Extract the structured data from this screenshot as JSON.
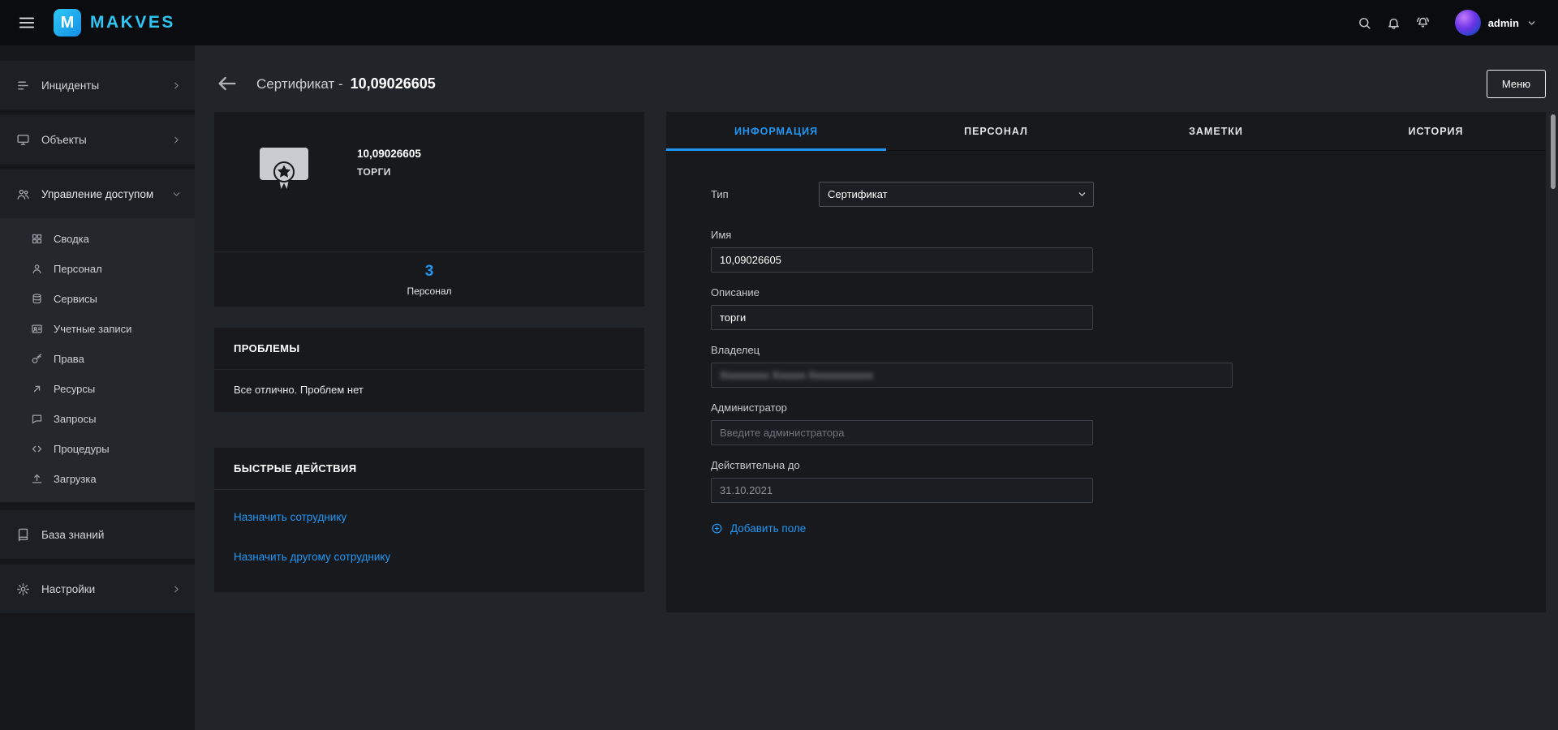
{
  "topbar": {
    "brand": "MAKVES",
    "user": "admin"
  },
  "sidebar": {
    "items": [
      {
        "id": "incidents",
        "label": "Инциденты",
        "icon": "incidents",
        "chevron": "right"
      },
      {
        "id": "objects",
        "label": "Объекты",
        "icon": "objects",
        "chevron": "right"
      },
      {
        "id": "access-management",
        "label": "Управление доступом",
        "icon": "access",
        "chevron": "down",
        "expanded": true
      },
      {
        "id": "knowledge-base",
        "label": "База знаний",
        "icon": "knowledge"
      },
      {
        "id": "settings",
        "label": "Настройки",
        "icon": "settings",
        "chevron": "right"
      }
    ],
    "submenu": [
      {
        "id": "summary",
        "label": "Сводка",
        "icon": "grid"
      },
      {
        "id": "personnel",
        "label": "Персонал",
        "icon": "person"
      },
      {
        "id": "services",
        "label": "Сервисы",
        "icon": "services"
      },
      {
        "id": "accounts",
        "label": "Учетные записи",
        "icon": "accounts"
      },
      {
        "id": "rights",
        "label": "Права",
        "icon": "rights"
      },
      {
        "id": "resources",
        "label": "Ресурсы",
        "icon": "resources"
      },
      {
        "id": "requests",
        "label": "Запросы",
        "icon": "requests"
      },
      {
        "id": "procedures",
        "label": "Процедуры",
        "icon": "procedures"
      },
      {
        "id": "upload",
        "label": "Загрузка",
        "icon": "upload"
      }
    ]
  },
  "header": {
    "title_prefix": "Сертификат -",
    "title_value": "10,09026605",
    "menu_button": "Меню"
  },
  "summary": {
    "name": "10,09026605",
    "subtitle": "ТОРГИ",
    "count": "3",
    "count_label": "Персонал"
  },
  "problems": {
    "title": "ПРОБЛЕМЫ",
    "message": "Все отлично. Проблем нет"
  },
  "quick_actions": {
    "title": "БЫСТРЫЕ ДЕЙСТВИЯ",
    "links": [
      "Назначить сотруднику",
      "Назначить другому сотруднику"
    ]
  },
  "tabs": [
    {
      "id": "information",
      "label": "ИНФОРМАЦИЯ",
      "active": true
    },
    {
      "id": "personnel",
      "label": "ПЕРСОНАЛ",
      "active": false
    },
    {
      "id": "notes",
      "label": "ЗАМЕТКИ",
      "active": false
    },
    {
      "id": "history",
      "label": "ИСТОРИЯ",
      "active": false
    }
  ],
  "form": {
    "fields": [
      {
        "key": "type",
        "label": "Тип",
        "control": "select",
        "value": "Сертификат"
      },
      {
        "key": "name",
        "label": "Имя",
        "control": "input",
        "value": "10,09026605"
      },
      {
        "key": "description",
        "label": "Описание",
        "control": "input",
        "value": "торги"
      },
      {
        "key": "owner",
        "label": "Владелец",
        "control": "input",
        "value": "Xxxxxxxxx Xxxxxx Xxxxxxxxxxxx",
        "redacted": true,
        "wide": true
      },
      {
        "key": "administrator",
        "label": "Администратор",
        "control": "input",
        "value": "",
        "placeholder": "Введите администратора"
      },
      {
        "key": "valid-until",
        "label": "Действительна до",
        "control": "input",
        "value": "31.10.2021",
        "muted": true
      }
    ],
    "add_field_label": "Добавить поле"
  },
  "colors": {
    "accent": "#2196f3",
    "brand": "#2fc5f3"
  }
}
